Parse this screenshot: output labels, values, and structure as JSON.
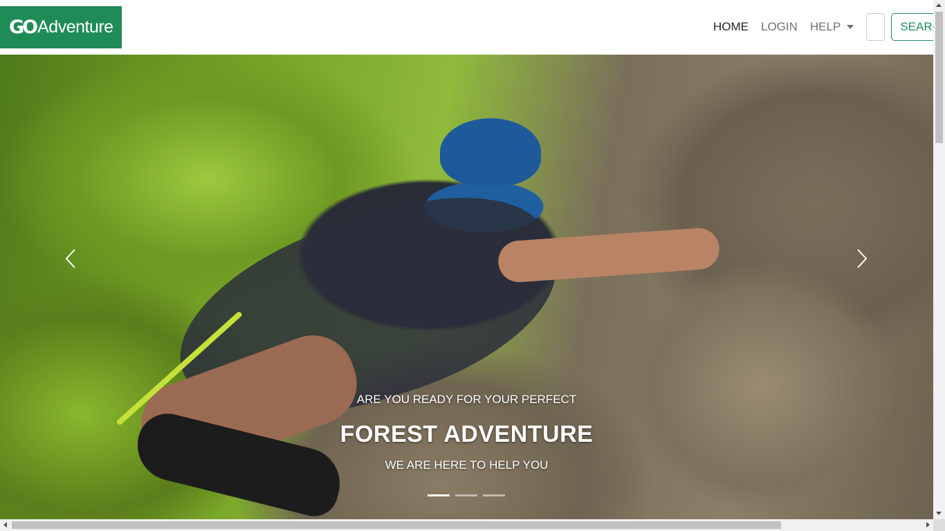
{
  "brand": {
    "logo_mark": "GO",
    "name": "Adventure",
    "color": "#1f8b57"
  },
  "nav": {
    "home": "HOME",
    "login": "LOGIN",
    "help": "HELP",
    "search_button": "SEARCH"
  },
  "carousel": {
    "pre_title": "ARE YOU READY FOR YOUR PERFECT",
    "title": "FOREST ADVENTURE",
    "subtitle": "WE ARE HERE TO HELP YOU",
    "slide_count": 3,
    "active_slide": 1,
    "prev_icon": "chevron-left-icon",
    "next_icon": "chevron-right-icon"
  }
}
